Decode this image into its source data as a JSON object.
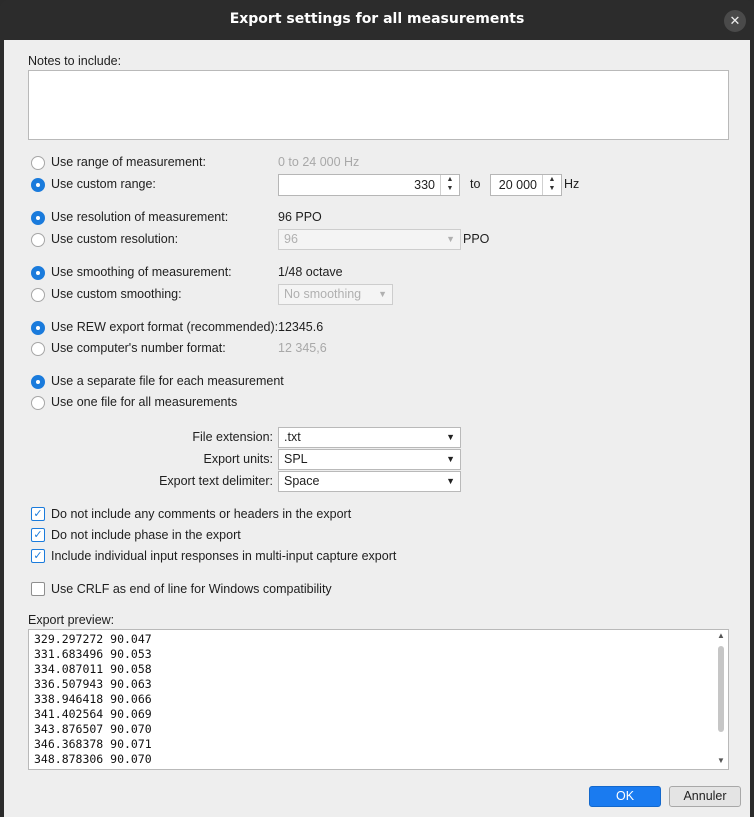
{
  "window": {
    "title": "Export settings for all measurements",
    "close_glyph": "✕"
  },
  "notes": {
    "label": "Notes to include:",
    "value": ""
  },
  "range": {
    "measurement_label": "Use range of measurement:",
    "measurement_value": "0 to 24 000 Hz",
    "custom_label": "Use custom range:",
    "from_value": "330",
    "to_label": "to",
    "to_value": "20 000",
    "unit": "Hz",
    "selected": "custom"
  },
  "resolution": {
    "measurement_label": "Use resolution of measurement:",
    "measurement_value": "96 PPO",
    "custom_label": "Use custom resolution:",
    "custom_value": "96",
    "unit": "PPO",
    "selected": "measurement"
  },
  "smoothing": {
    "measurement_label": "Use smoothing of measurement:",
    "measurement_value": "1/48 octave",
    "custom_label": "Use custom smoothing:",
    "custom_value": "No smoothing",
    "selected": "measurement"
  },
  "number_format": {
    "rew_label": "Use REW export format (recommended):",
    "rew_example": "12345.6",
    "computer_label": "Use computer's number format:",
    "computer_example": "12 345,6",
    "selected": "rew"
  },
  "files": {
    "separate_label": "Use a separate file for each measurement",
    "one_label": "Use one file for all measurements",
    "selected": "separate"
  },
  "options": {
    "file_extension_label": "File extension:",
    "file_extension_value": ".txt",
    "export_units_label": "Export units:",
    "export_units_value": "SPL",
    "delimiter_label": "Export text delimiter:",
    "delimiter_value": "Space"
  },
  "checks": {
    "no_comments_label": "Do not include any comments or headers in the export",
    "no_comments_checked": true,
    "no_phase_label": "Do not include phase in the export",
    "no_phase_checked": true,
    "individual_label": "Include individual input responses in multi-input capture export",
    "individual_checked": true,
    "crlf_label": "Use CRLF as end of line for Windows compatibility",
    "crlf_checked": false
  },
  "preview": {
    "label": "Export preview:",
    "lines": [
      "329.297272 90.047",
      "331.683496 90.053",
      "334.087011 90.058",
      "336.507943 90.063",
      "338.946418 90.066",
      "341.402564 90.069",
      "343.876507 90.070",
      "346.368378 90.071",
      "348.878306 90.070"
    ]
  },
  "buttons": {
    "ok": "OK",
    "cancel": "Annuler"
  },
  "colors": {
    "accent": "#1a7bdc",
    "titlebar": "#2c2c2c",
    "dialog_bg": "#eeeeee"
  },
  "icons": {
    "close": "close-icon",
    "spinner": "spinner-arrows-icon",
    "dropdown": "chevron-down-icon",
    "check": "checkmark-icon"
  }
}
